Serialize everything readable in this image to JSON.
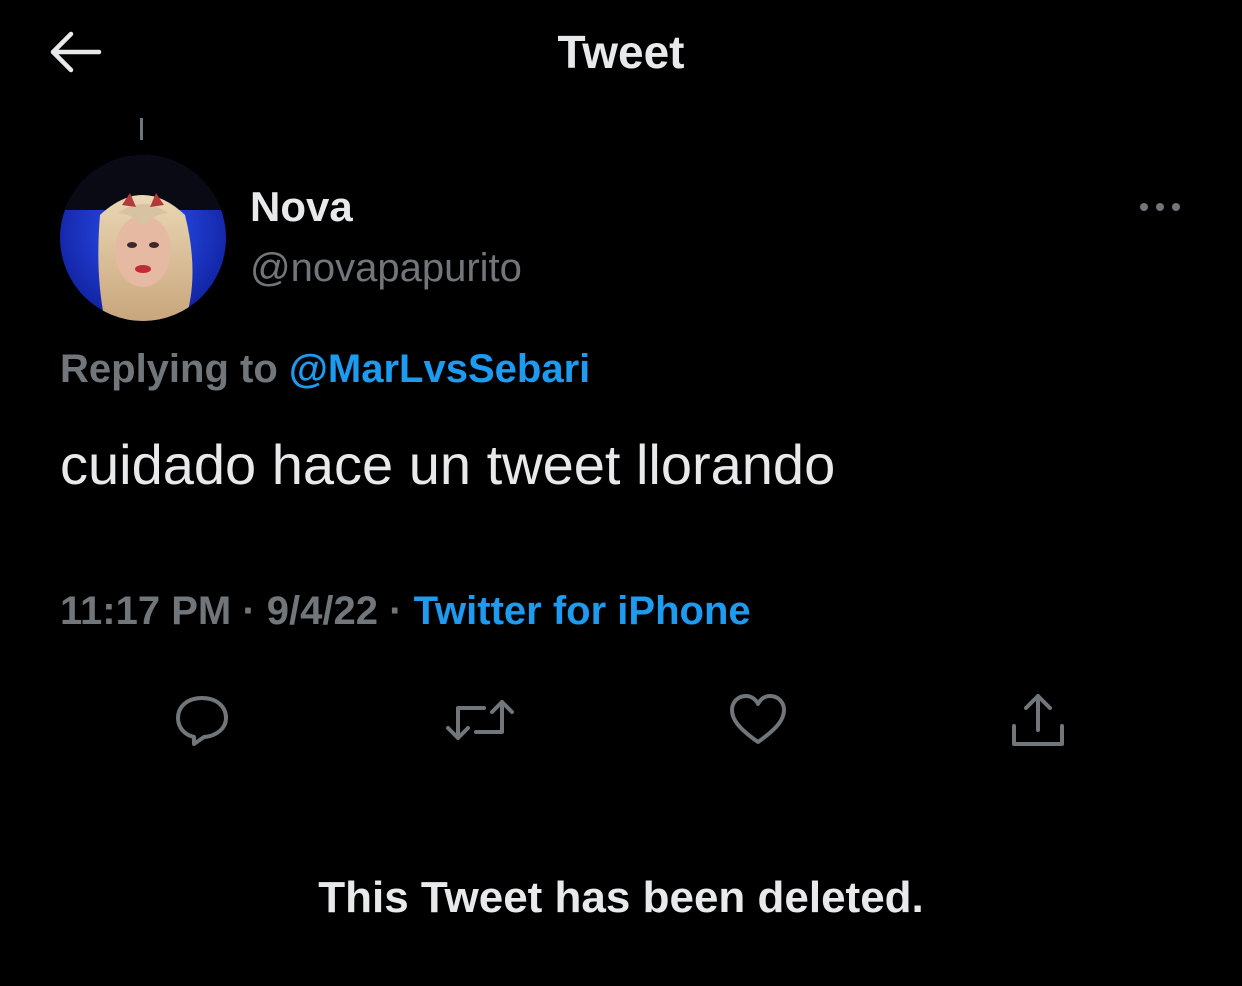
{
  "header": {
    "title": "Tweet",
    "back_icon": "arrow-left-icon"
  },
  "tweet": {
    "author": {
      "name": "Nova",
      "handle": "@novapapurito"
    },
    "more_icon": "more-horizontal-icon",
    "replying_to": {
      "prefix": "Replying to",
      "handle": "@MarLvsSebari"
    },
    "text": "cuidado hace un tweet llorando",
    "meta": {
      "time": "11:17 PM",
      "separator": "·",
      "date": "9/4/22",
      "source": "Twitter for iPhone"
    },
    "actions": [
      {
        "name": "reply",
        "icon": "reply-icon"
      },
      {
        "name": "retweet",
        "icon": "retweet-icon"
      },
      {
        "name": "like",
        "icon": "heart-icon"
      },
      {
        "name": "share",
        "icon": "share-icon"
      }
    ]
  },
  "deleted_notice": "This Tweet has been deleted.",
  "colors": {
    "background": "#000000",
    "primary_text": "#e7e9ea",
    "secondary_text": "#71767b",
    "link": "#1d9bf0",
    "icon": "#71767b",
    "avatar_bg": "#1f3fd1"
  }
}
